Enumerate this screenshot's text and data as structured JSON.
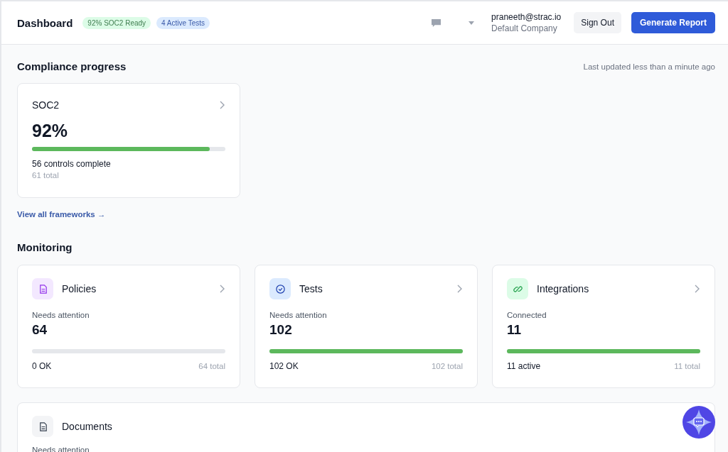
{
  "header": {
    "title": "Dashboard",
    "badges": [
      {
        "label": "92% SOC2 Ready",
        "kind": "success"
      },
      {
        "label": "4 Active Tests",
        "kind": "info"
      }
    ],
    "user": {
      "email": "praneeth@strac.io",
      "company": "Default Company"
    },
    "buttons": [
      {
        "label": "Sign Out",
        "kind": "secondary"
      },
      {
        "label": "Generate Report",
        "kind": "primary"
      }
    ]
  },
  "compliance": {
    "title": "Compliance progress",
    "updated": "Last updated less than a minute ago",
    "frameworks": [
      {
        "name": "SOC2",
        "percent": "92%",
        "level": 0.92,
        "complete": "56 controls complete",
        "total": "61 total"
      }
    ],
    "link": "View all frameworks →"
  },
  "monitoring": {
    "title": "Monitoring",
    "cards": [
      {
        "kind": "policy",
        "title": "Policies",
        "caption": "Needs attention",
        "value": "64",
        "level": 0,
        "ok": "0 OK",
        "total": "64 total"
      },
      {
        "kind": "test",
        "title": "Tests",
        "caption": "Needs attention",
        "value": "102",
        "level": 1,
        "ok": "102 OK",
        "total": "102 total"
      },
      {
        "kind": "integration",
        "title": "Integrations",
        "caption": "Connected",
        "value": "11",
        "level": 1,
        "ok": "11 active",
        "total": "11 total"
      }
    ],
    "documents": {
      "kind": "document",
      "title": "Documents",
      "caption": "Needs attention"
    }
  }
}
